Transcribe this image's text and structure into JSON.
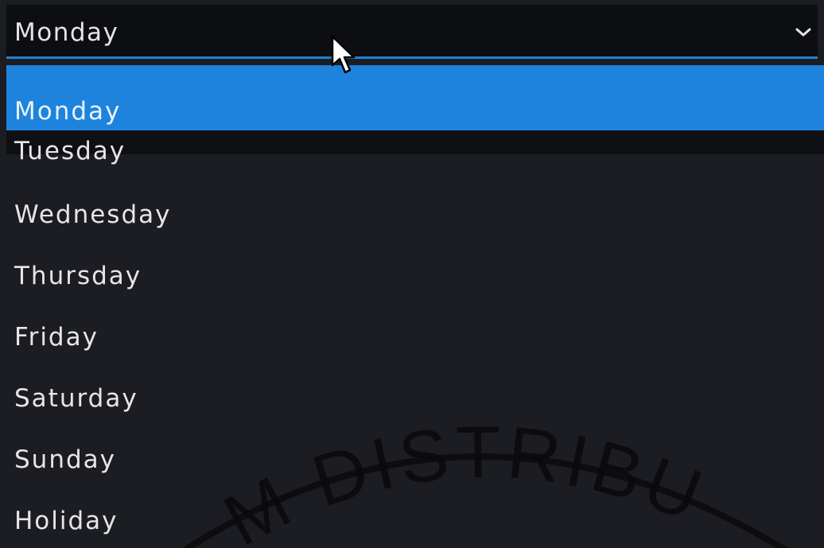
{
  "select": {
    "value": "Monday"
  },
  "options": [
    "Monday",
    "Tuesday",
    "Wednesday",
    "Thursday",
    "Friday",
    "Saturday",
    "Sunday",
    "Holiday"
  ],
  "selected_option": "Monday",
  "watermark_text": "M DISTRIBU",
  "icons": {
    "dropdown_arrow": "chevron-down-icon",
    "pointer": "mouse-cursor-icon"
  },
  "colors": {
    "accent": "#1e83dc",
    "background": "#1c1d22",
    "select_background": "#0d0e12",
    "text": "#e6e6e6"
  }
}
